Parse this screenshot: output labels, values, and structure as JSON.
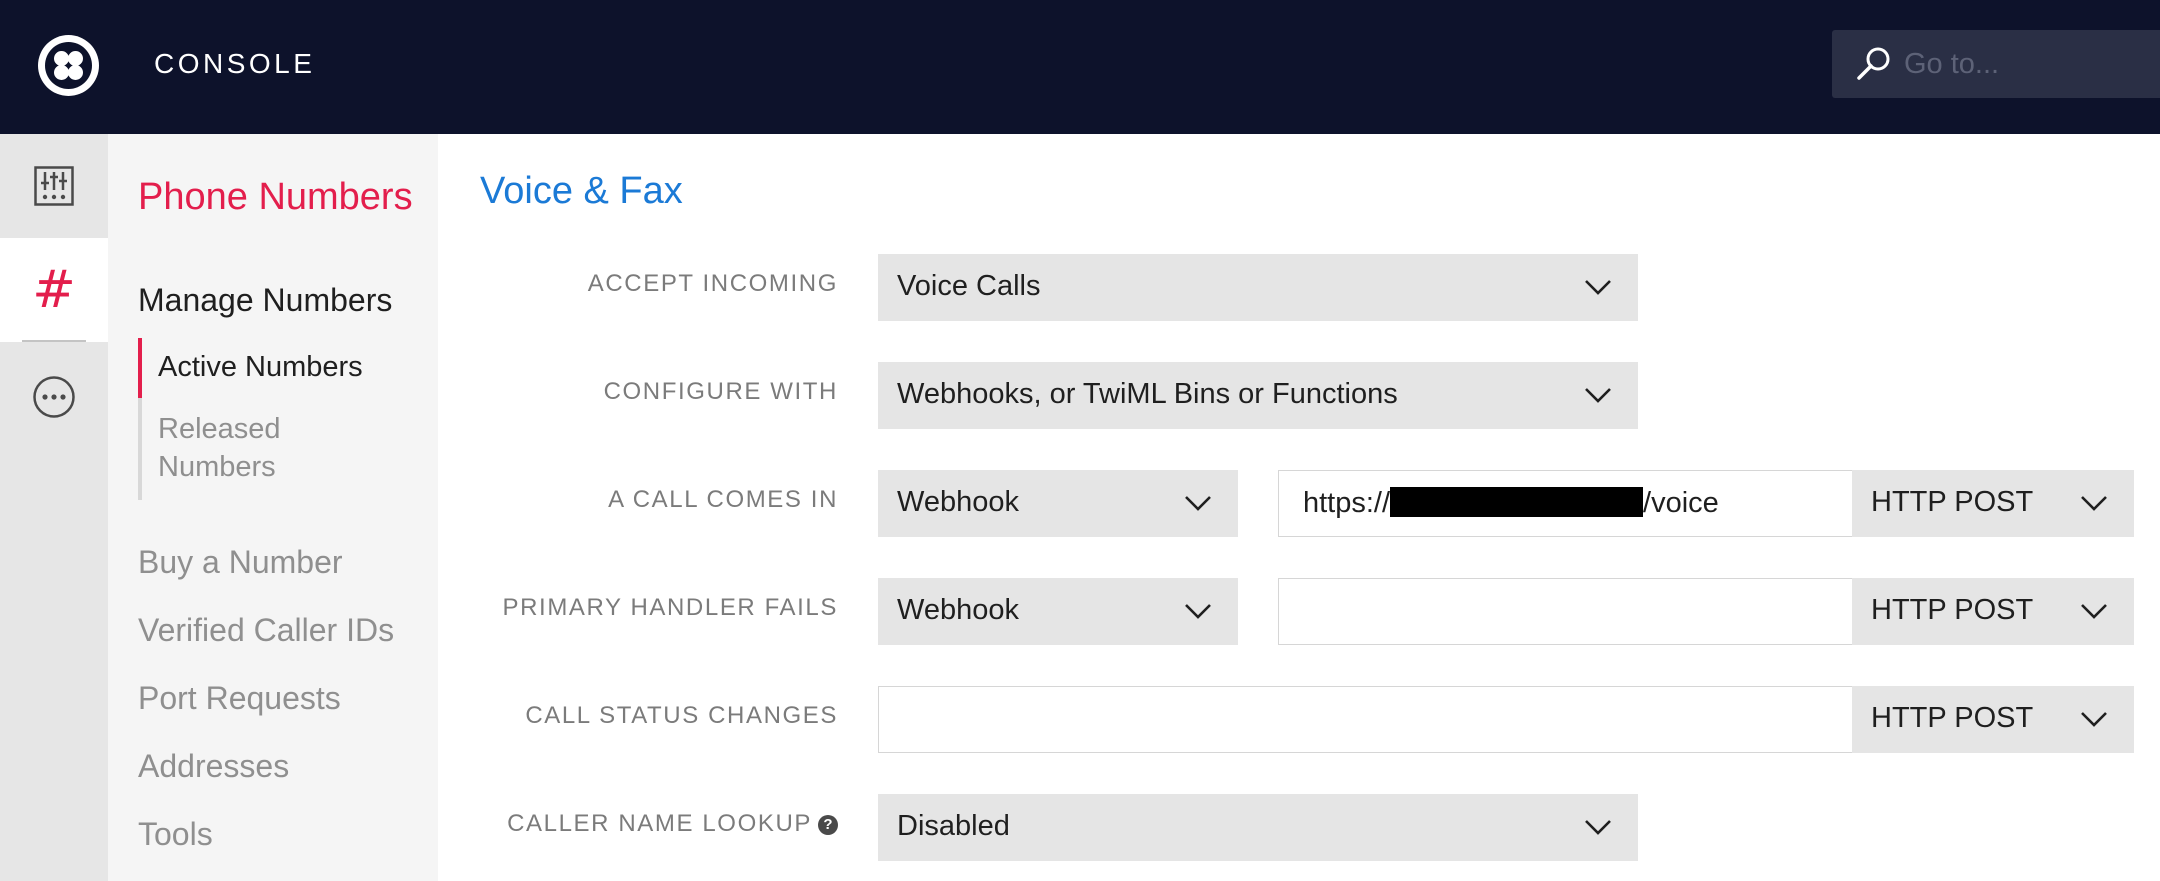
{
  "header": {
    "app_title": "CONSOLE",
    "search_placeholder": "Go to...",
    "colors": {
      "background": "#0d122b",
      "accent": "#e31e4c",
      "link": "#1b7ad6"
    }
  },
  "rail": {
    "items": [
      {
        "icon": "dashboard-sliders-icon",
        "active": false
      },
      {
        "icon": "hash-icon",
        "glyph": "#",
        "active": true
      },
      {
        "icon": "more-icon",
        "active": false
      }
    ]
  },
  "sidebar": {
    "title": "Phone Numbers",
    "section_heading": "Manage Numbers",
    "subitems": [
      "Active Numbers",
      "Released Numbers"
    ],
    "links": [
      "Buy a Number",
      "Verified Caller IDs",
      "Port Requests",
      "Addresses",
      "Tools"
    ]
  },
  "main": {
    "section_title": "Voice & Fax",
    "rows": {
      "accept_incoming": {
        "label": "ACCEPT INCOMING",
        "value": "Voice Calls"
      },
      "configure_with": {
        "label": "CONFIGURE WITH",
        "value": "Webhooks, or TwiML Bins or Functions"
      },
      "call_comes_in": {
        "label": "A CALL COMES IN",
        "type": "Webhook",
        "url_prefix": "https://",
        "url_suffix": "/voice",
        "method": "HTTP POST"
      },
      "primary_handler_fails": {
        "label": "PRIMARY HANDLER FAILS",
        "type": "Webhook",
        "url": "",
        "method": "HTTP POST"
      },
      "call_status_changes": {
        "label": "CALL STATUS CHANGES",
        "url": "",
        "method": "HTTP POST"
      },
      "caller_name_lookup": {
        "label": "CALLER NAME LOOKUP",
        "help_glyph": "?",
        "value": "Disabled"
      }
    }
  }
}
